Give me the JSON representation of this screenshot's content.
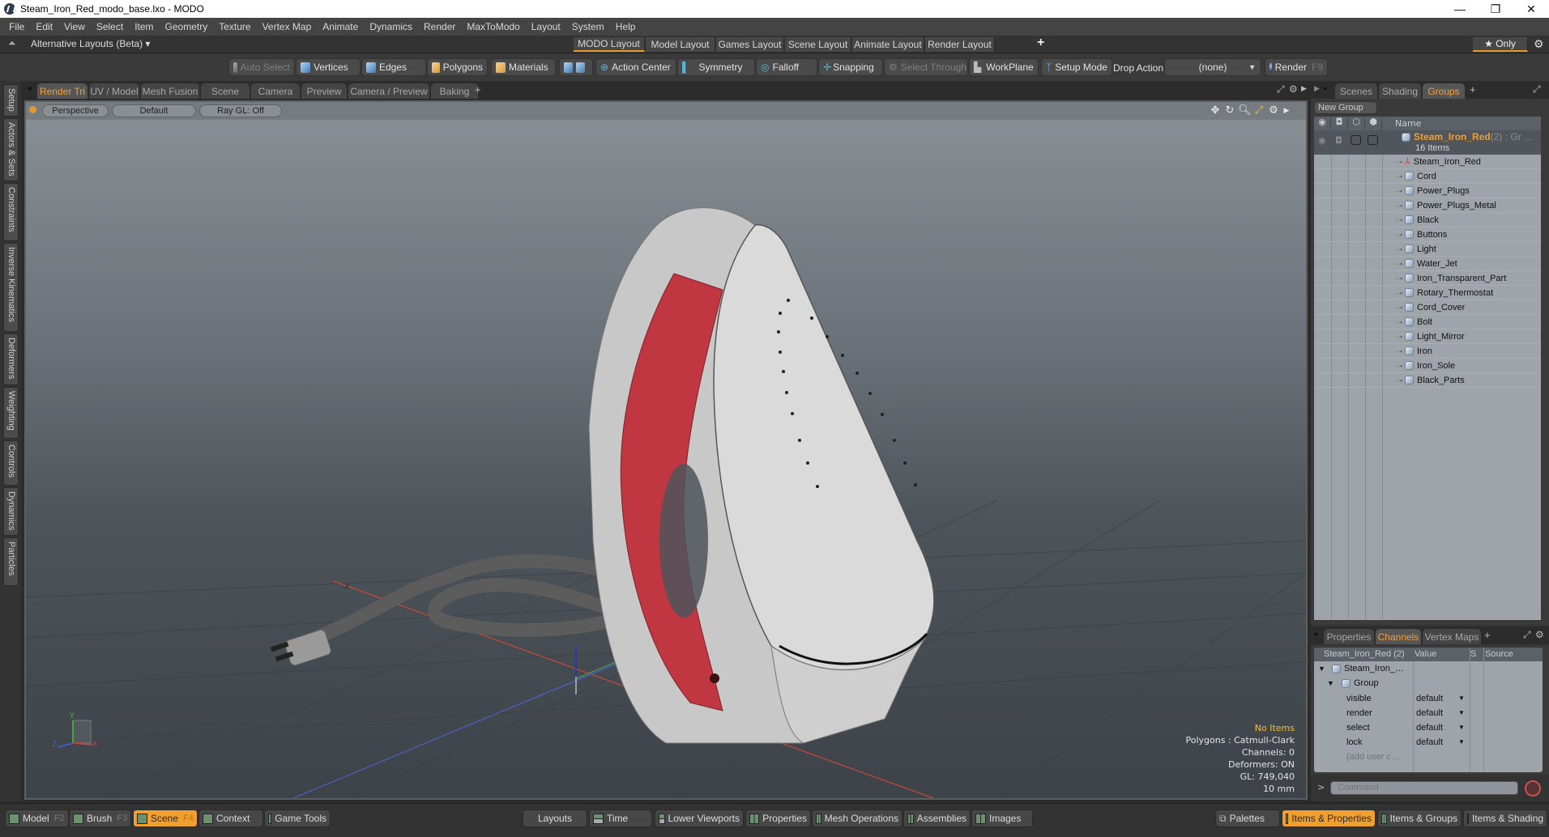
{
  "window": {
    "title": "Steam_Iron_Red_modo_base.lxo - MODO",
    "controls": [
      "minimize",
      "restore",
      "close"
    ]
  },
  "menu": [
    "File",
    "Edit",
    "View",
    "Select",
    "Item",
    "Geometry",
    "Texture",
    "Vertex Map",
    "Animate",
    "Dynamics",
    "Render",
    "MaxToModo",
    "Layout",
    "System",
    "Help"
  ],
  "layoutbar": {
    "alternative": "Alternative Layouts (Beta) ▾",
    "tabs": [
      "MODO Layout",
      "Model Layout",
      "Games Layout",
      "Scene Layout",
      "Animate Layout",
      "Render Layout"
    ],
    "active_tab": "MODO Layout",
    "add": "+",
    "only": "★  Only"
  },
  "toolbar": {
    "auto_select": "Auto Select",
    "vertices": "Vertices",
    "edges": "Edges",
    "polygons": "Polygons",
    "materials": "Materials",
    "action_center": "Action Center",
    "symmetry": "Symmetry",
    "falloff": "Falloff",
    "snapping": "Snapping",
    "select_through": "Select Through",
    "workplane": "WorkPlane",
    "setup_mode": "Setup Mode",
    "drop_action_label": "Drop Action",
    "drop_action_value": "(none)",
    "render": "Render",
    "render_key": "F9"
  },
  "left_tabs": [
    "Setup",
    "Actors & Sets",
    "Constraints",
    "Inverse Kinematics",
    "Deformers",
    "Weighting",
    "Controls",
    "Dynamics",
    "Particles"
  ],
  "viewport_tabs": {
    "tabs": [
      "Render Tri",
      "UV / Model",
      "Mesh Fusion",
      "Scene",
      "Camera",
      "Preview",
      "Camera / Preview",
      "Baking"
    ],
    "active": "Render Tri",
    "add": "+"
  },
  "viewport": {
    "view": "Perspective",
    "style": "Default",
    "raygl": "Ray GL: Off",
    "axis_label_neg_x": "-X",
    "mini_axes": {
      "x": "X",
      "y": "Y",
      "z": "Z"
    },
    "info": {
      "selection": "No Items",
      "polygons": "Polygons : Catmull-Clark",
      "channels": "Channels: 0",
      "deformers": "Deformers: ON",
      "gl": "GL: 749,040",
      "unit": "10 mm"
    },
    "colors": {
      "iron_red": "#c0303a",
      "iron_white": "#d8d8d8",
      "grid_x": "#d04030",
      "grid_z": "#4060d0"
    }
  },
  "groups_panel": {
    "tabs": [
      "Scenes",
      "Shading",
      "Groups"
    ],
    "active": "Groups",
    "add": "+",
    "new_group": "New Group",
    "header_name": "Name",
    "group": {
      "name": "Steam_Iron_Red",
      "suffix": " (2) : Gr …",
      "count": "16 Items"
    },
    "items": [
      "Steam_Iron_Red",
      "Cord",
      "Power_Plugs",
      "Power_Plugs_Metal",
      "Black",
      "Buttons",
      "Light",
      "Water_Jet",
      "Iron_Transparent_Part",
      "Rotary_Thermostat",
      "Cord_Cover",
      "Bolt",
      "Light_Mirror",
      "Iron",
      "Iron_Sole",
      "Black_Parts"
    ]
  },
  "channels_panel": {
    "tabs": [
      "Properties",
      "Channels",
      "Vertex Maps"
    ],
    "active": "Channels",
    "add": "+",
    "headers": [
      "Steam_Iron_Red (2)",
      "Value",
      "S",
      "Source"
    ],
    "root": "Steam_Iron_…",
    "group": "Group",
    "rows": [
      {
        "name": "visible",
        "value": "default"
      },
      {
        "name": "render",
        "value": "default"
      },
      {
        "name": "select",
        "value": "default"
      },
      {
        "name": "lock",
        "value": "default"
      }
    ],
    "add_user": "(add user c…"
  },
  "command": {
    "prompt": ">",
    "placeholder": "Command"
  },
  "bottombar": {
    "left": [
      {
        "label": "Model",
        "key": "F2"
      },
      {
        "label": "Brush",
        "key": "F3"
      },
      {
        "label": "Scene",
        "key": "F4",
        "active": true
      },
      {
        "label": "Context",
        "key": ""
      },
      {
        "label": "Game Tools",
        "key": ""
      }
    ],
    "middle": [
      "Layouts",
      "Time",
      "Lower Viewports",
      "Properties",
      "Mesh Operations",
      "Assemblies",
      "Images"
    ],
    "right": [
      "Palettes",
      "Items & Properties",
      "Items & Groups",
      "Items & Shading"
    ],
    "right_active": "Items & Properties"
  }
}
